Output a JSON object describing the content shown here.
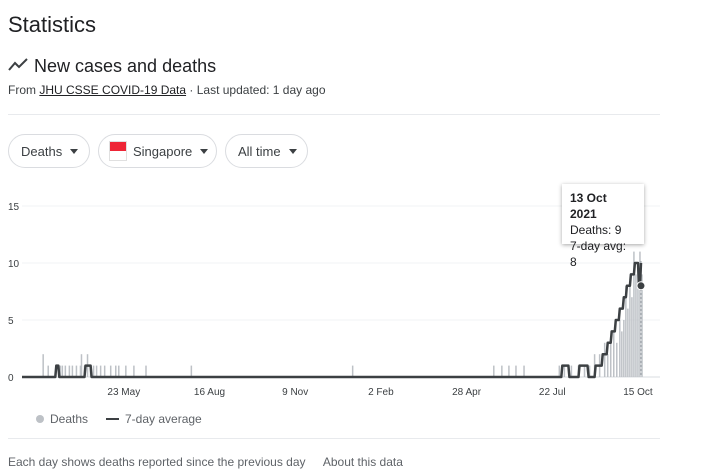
{
  "page": {
    "title": "Statistics"
  },
  "section": {
    "title": "New cases and deaths",
    "icon": "trending-line-icon",
    "source_prefix": "From",
    "source_link": "JHU CSSE COVID-19 Data",
    "updated": "· Last updated: 1 day ago"
  },
  "filters": {
    "metric": "Deaths",
    "location": "Singapore",
    "location_flag": "singapore-flag-icon",
    "range": "All time"
  },
  "tooltip": {
    "date": "13 Oct 2021",
    "deaths": "Deaths: 9",
    "avg": "7-day avg: 8"
  },
  "legend": {
    "deaths": "Deaths",
    "avg": "7-day average",
    "bar_color": "#bdc1c6",
    "line_color": "#3c4043"
  },
  "footer": {
    "text": "Each day shows deaths reported since the previous day",
    "link": "About this data"
  },
  "chart_data": {
    "type": "bar",
    "y_ticks": [
      "0",
      "5",
      "10",
      "15"
    ],
    "ylim": [
      0,
      15
    ],
    "x_ticks": [
      "23 May",
      "16 Aug",
      "9 Nov",
      "2 Feb",
      "28 Apr",
      "22 Jul",
      "15 Oct"
    ],
    "x_tick_days": [
      123,
      208,
      293,
      378,
      463,
      548,
      633
    ],
    "x_range_days": [
      22,
      639
    ],
    "grid": true,
    "series": [
      {
        "name": "Deaths",
        "points": [
          [
            43,
            2
          ],
          [
            48,
            1
          ],
          [
            60,
            1
          ],
          [
            62,
            1
          ],
          [
            65,
            1
          ],
          [
            69,
            1
          ],
          [
            72,
            1
          ],
          [
            76,
            1
          ],
          [
            80,
            1
          ],
          [
            81,
            2
          ],
          [
            84,
            1
          ],
          [
            87,
            2
          ],
          [
            90,
            1
          ],
          [
            93,
            1
          ],
          [
            96,
            1
          ],
          [
            100,
            1
          ],
          [
            104,
            1
          ],
          [
            110,
            1
          ],
          [
            115,
            1
          ],
          [
            118,
            1
          ],
          [
            125,
            1
          ],
          [
            133,
            1
          ],
          [
            145,
            1
          ],
          [
            190,
            1
          ],
          [
            350,
            1
          ],
          [
            490,
            1
          ],
          [
            498,
            1
          ],
          [
            505,
            1
          ],
          [
            512,
            1
          ],
          [
            520,
            1
          ],
          [
            555,
            1
          ],
          [
            560,
            1
          ],
          [
            567,
            1
          ],
          [
            574,
            1
          ],
          [
            580,
            1
          ],
          [
            585,
            1
          ],
          [
            590,
            2
          ],
          [
            595,
            2
          ],
          [
            600,
            3
          ],
          [
            603,
            2
          ],
          [
            606,
            3
          ],
          [
            609,
            4
          ],
          [
            612,
            3
          ],
          [
            615,
            5
          ],
          [
            617,
            4
          ],
          [
            619,
            5
          ],
          [
            621,
            8
          ],
          [
            623,
            6
          ],
          [
            625,
            8
          ],
          [
            627,
            7
          ],
          [
            629,
            11
          ],
          [
            631,
            9
          ],
          [
            633,
            10
          ],
          [
            635,
            11
          ],
          [
            637,
            9
          ]
        ]
      },
      {
        "name": "7-day average",
        "points": [
          [
            22,
            0
          ],
          [
            55,
            0
          ],
          [
            56,
            1
          ],
          [
            58,
            1
          ],
          [
            59,
            0
          ],
          [
            84,
            0
          ],
          [
            85,
            1
          ],
          [
            90,
            1
          ],
          [
            91,
            0
          ],
          [
            557,
            0
          ],
          [
            558,
            1
          ],
          [
            564,
            1
          ],
          [
            565,
            0
          ],
          [
            574,
            0
          ],
          [
            575,
            1
          ],
          [
            583,
            1
          ],
          [
            584,
            0
          ],
          [
            590,
            0
          ],
          [
            591,
            1
          ],
          [
            597,
            1
          ],
          [
            598,
            2
          ],
          [
            602,
            2
          ],
          [
            603,
            3
          ],
          [
            606,
            3
          ],
          [
            607,
            4
          ],
          [
            610,
            4
          ],
          [
            611,
            5
          ],
          [
            614,
            5
          ],
          [
            615,
            6
          ],
          [
            618,
            6
          ],
          [
            619,
            7
          ],
          [
            621,
            7
          ],
          [
            622,
            8
          ],
          [
            625,
            8
          ],
          [
            626,
            9
          ],
          [
            629,
            9
          ],
          [
            630,
            10
          ],
          [
            633,
            10
          ],
          [
            634,
            8
          ],
          [
            635,
            8
          ],
          [
            636,
            10
          ]
        ]
      }
    ],
    "highlight": {
      "date": "13 Oct 2021",
      "deaths": 9,
      "avg": 8
    }
  }
}
